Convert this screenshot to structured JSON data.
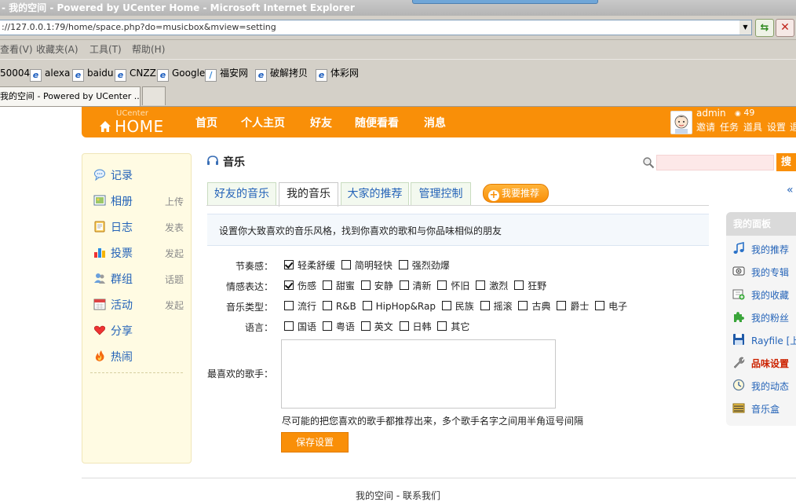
{
  "browser": {
    "window_title": "- 我的空间 - Powered by UCenter Home - Microsoft Internet Explorer",
    "address": "://127.0.0.1:79/home/space.php?do=musicbox&mview=setting",
    "menu": [
      "查看(V)",
      "收藏夹(A)",
      "工具(T)",
      "帮助(H)"
    ],
    "links": [
      "50004",
      "alexa",
      "baidu",
      "CNZZ",
      "Google",
      "福安网",
      "破解拷贝",
      "体彩网"
    ],
    "tab_title": "我的空间 - Powered by UCenter ..."
  },
  "header": {
    "logo_small": "UCenter",
    "logo_big": "HOME",
    "nav": [
      "首页",
      "个人主页",
      "好友",
      "随便看看",
      "消息"
    ],
    "username": "admin",
    "credits": "49",
    "user_links": [
      "邀请",
      "任务",
      "道具",
      "设置",
      "退"
    ]
  },
  "sidebar": {
    "items": [
      {
        "label": "记录",
        "action": "",
        "icon": "record-icon"
      },
      {
        "label": "相册",
        "action": "上传",
        "icon": "album-icon"
      },
      {
        "label": "日志",
        "action": "发表",
        "icon": "blog-icon"
      },
      {
        "label": "投票",
        "action": "发起",
        "icon": "poll-icon"
      },
      {
        "label": "群组",
        "action": "话题",
        "icon": "group-icon"
      },
      {
        "label": "活动",
        "action": "发起",
        "icon": "event-icon"
      },
      {
        "label": "分享",
        "action": "",
        "icon": "share-icon"
      },
      {
        "label": "热闹",
        "action": "",
        "icon": "hot-icon"
      }
    ]
  },
  "main": {
    "title": "音乐",
    "search_button": "搜",
    "tabs": [
      "好友的音乐",
      "我的音乐",
      "大家的推荐",
      "管理控制"
    ],
    "active_tab": 1,
    "recommend_button": "我要推荐",
    "collapse_arrow": "«",
    "intro": "设置你大致喜欢的音乐风格，找到你喜欢的歌和与你品味相似的朋友",
    "form": {
      "rhythm": {
        "label": "节奏感：",
        "options": [
          {
            "text": "轻柔舒缓",
            "checked": true
          },
          {
            "text": "简明轻快",
            "checked": false
          },
          {
            "text": "强烈劲爆",
            "checked": false
          }
        ]
      },
      "emotion": {
        "label": "情感表达：",
        "options": [
          {
            "text": "伤感",
            "checked": true
          },
          {
            "text": "甜蜜",
            "checked": false
          },
          {
            "text": "安静",
            "checked": false
          },
          {
            "text": "清新",
            "checked": false
          },
          {
            "text": "怀旧",
            "checked": false
          },
          {
            "text": "激烈",
            "checked": false
          },
          {
            "text": "狂野",
            "checked": false
          }
        ]
      },
      "genre": {
        "label": "音乐类型：",
        "options": [
          {
            "text": "流行",
            "checked": false
          },
          {
            "text": "R&B",
            "checked": false
          },
          {
            "text": "HipHop&Rap",
            "checked": false
          },
          {
            "text": "民族",
            "checked": false
          },
          {
            "text": "摇滚",
            "checked": false
          },
          {
            "text": "古典",
            "checked": false
          },
          {
            "text": "爵士",
            "checked": false
          },
          {
            "text": "电子",
            "checked": false
          }
        ]
      },
      "language": {
        "label": "语言：",
        "options": [
          {
            "text": "国语",
            "checked": false
          },
          {
            "text": "粤语",
            "checked": false
          },
          {
            "text": "英文",
            "checked": false
          },
          {
            "text": "日韩",
            "checked": false
          },
          {
            "text": "其它",
            "checked": false
          }
        ]
      },
      "singer_label": "最喜欢的歌手：",
      "singer_value": "",
      "singer_hint": "尽可能的把您喜欢的歌手都推荐出来，多个歌手名字之间用半角逗号间隔",
      "save_label": "保存设置"
    }
  },
  "right_panel": {
    "title": "我的面板",
    "items": [
      {
        "label": "我的推荐",
        "icon": "music-note-icon",
        "highlight": false
      },
      {
        "label": "我的专辑",
        "icon": "cd-icon",
        "highlight": false
      },
      {
        "label": "我的收藏",
        "icon": "add-favorite-icon",
        "highlight": false
      },
      {
        "label": "我的粉丝",
        "icon": "puzzle-icon",
        "highlight": false
      },
      {
        "label": "Rayfile [上",
        "icon": "save-disk-icon",
        "highlight": false
      },
      {
        "label": "品味设置",
        "icon": "wrench-icon",
        "highlight": true
      },
      {
        "label": "我的动态",
        "icon": "clock-icon",
        "highlight": false
      },
      {
        "label": "音乐盒",
        "icon": "musicbox-icon",
        "highlight": false
      }
    ]
  },
  "footer": {
    "links": [
      "我的空间",
      "联系我们"
    ],
    "separator": " - "
  },
  "colors": {
    "brand_orange": "#f98f08",
    "link_blue": "#2463b8",
    "highlight_red": "#cc2200",
    "sidebar_bg": "#fffbe3"
  }
}
